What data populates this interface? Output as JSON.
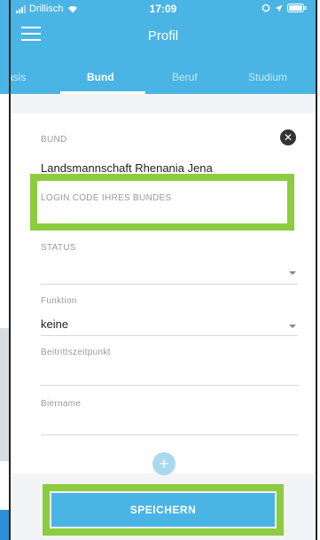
{
  "statusbar": {
    "carrier": "Drillisch",
    "time": "17:09"
  },
  "navbar": {
    "title": "Profil"
  },
  "tabs": [
    {
      "label": "asis",
      "active": false
    },
    {
      "label": "Bund",
      "active": true
    },
    {
      "label": "Beruf",
      "active": false
    },
    {
      "label": "Studium",
      "active": false
    }
  ],
  "form": {
    "bund_label": "BUND",
    "bund_value": "Landsmannschaft Rhenania Jena",
    "login_code_placeholder": "LOGIN CODE IHRES BUNDES",
    "status_label": "STATUS",
    "funktion_label": "Funktion",
    "funktion_value": "keine",
    "beitritt_label": "Beitrittszeitpunkt",
    "biername_label": "Biername"
  },
  "actions": {
    "add_symbol": "+",
    "save_label": "SPEICHERN"
  },
  "colors": {
    "primary": "#4ab5e4",
    "highlight": "#8dcb3f"
  }
}
